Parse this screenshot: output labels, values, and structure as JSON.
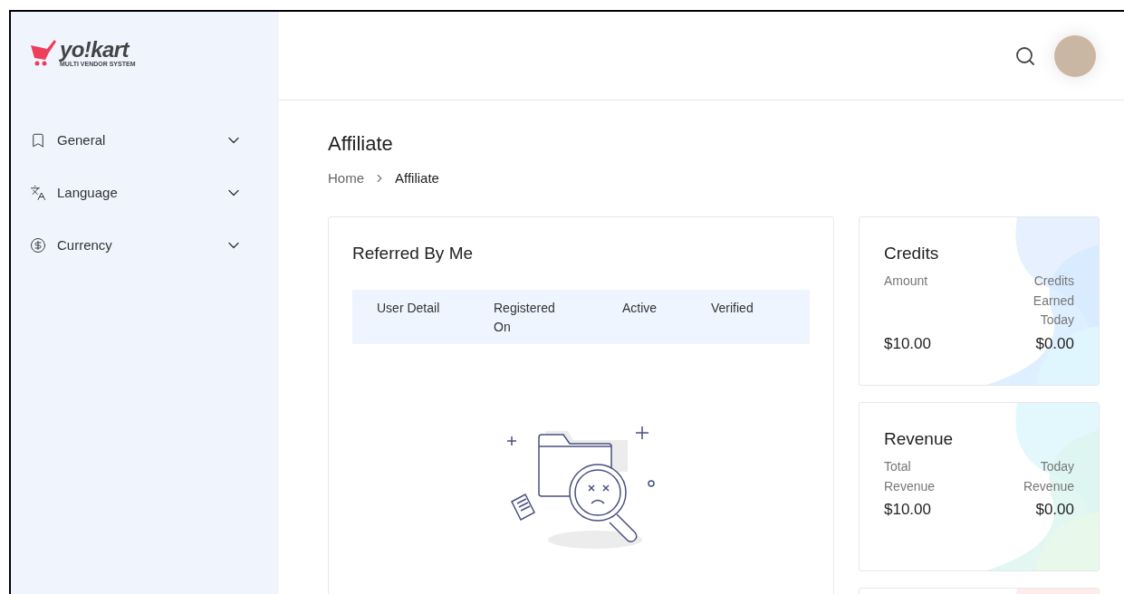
{
  "logo": {
    "name": "yo!kart",
    "tagline": "MULTI VENDOR SYSTEM"
  },
  "sidebar": {
    "items": [
      {
        "label": "General",
        "expanded": false
      },
      {
        "label": "Language",
        "expanded": false
      },
      {
        "label": "Currency",
        "expanded": false
      }
    ]
  },
  "page": {
    "title": "Affiliate",
    "breadcrumb": [
      "Home",
      "Affiliate"
    ]
  },
  "referred": {
    "title": "Referred By Me",
    "columns": [
      "User Detail",
      "Registered On",
      "Active",
      "Verified"
    ]
  },
  "cards": [
    {
      "title": "Credits",
      "stats": [
        {
          "label": "Amount",
          "value": "$10.00"
        },
        {
          "label": "Credits Earned Today",
          "value": "$0.00"
        }
      ]
    },
    {
      "title": "Revenue",
      "stats": [
        {
          "label": "Total Revenue",
          "value": "$10.00"
        },
        {
          "label": "Today Revenue",
          "value": "$0.00"
        }
      ]
    }
  ]
}
